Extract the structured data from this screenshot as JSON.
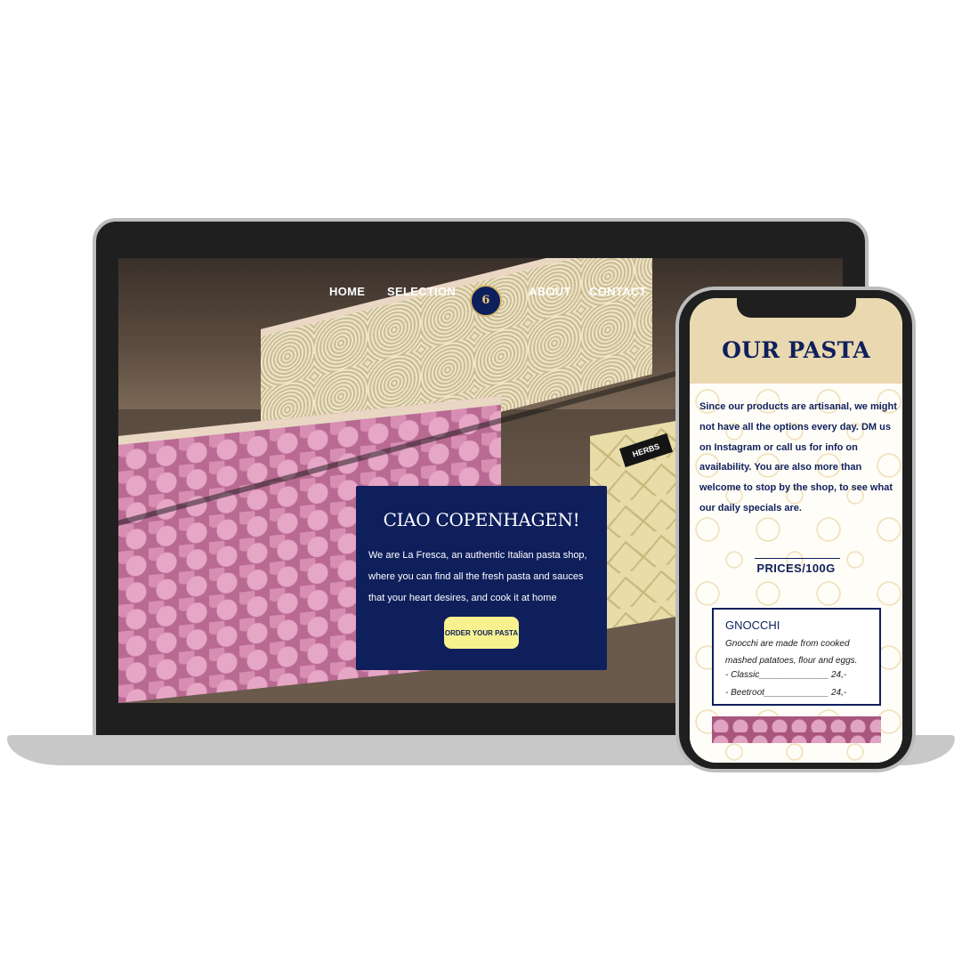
{
  "laptop": {
    "nav": {
      "home": "HOME",
      "selection": "SELECTION",
      "about": "ABOUT",
      "contact": "CONTACT",
      "logo_text": "6"
    },
    "herbs_tag": "HERBS",
    "hero": {
      "title": "CIAO COPENHAGEN!",
      "text": "We are La Fresca, an authentic Italian pasta shop, where you can find all the fresh pasta and sauces that your heart desires, and cook it at home",
      "button_label": "ORDER YOUR PASTA"
    }
  },
  "phone": {
    "title": "OUR PASTA",
    "intro": "Since our products are artisanal, we might not have all the options every day. DM us on Instagram or call us for info on availability. You are also more than welcome to stop by the shop, to see what our daily specials are.",
    "prices_heading": "PRICES/100G",
    "card": {
      "title": "GNOCCHI",
      "description": "Gnocchi are made from cooked mashed patatoes, flour and eggs.",
      "prices": [
        {
          "label": "- Classic______________ 24,-"
        },
        {
          "label": "- Beetroot_____________ 24,-"
        }
      ]
    }
  },
  "colors": {
    "navy": "#0f1f5c",
    "cream": "#ead8b0",
    "button_yellow": "#f7f28f"
  }
}
